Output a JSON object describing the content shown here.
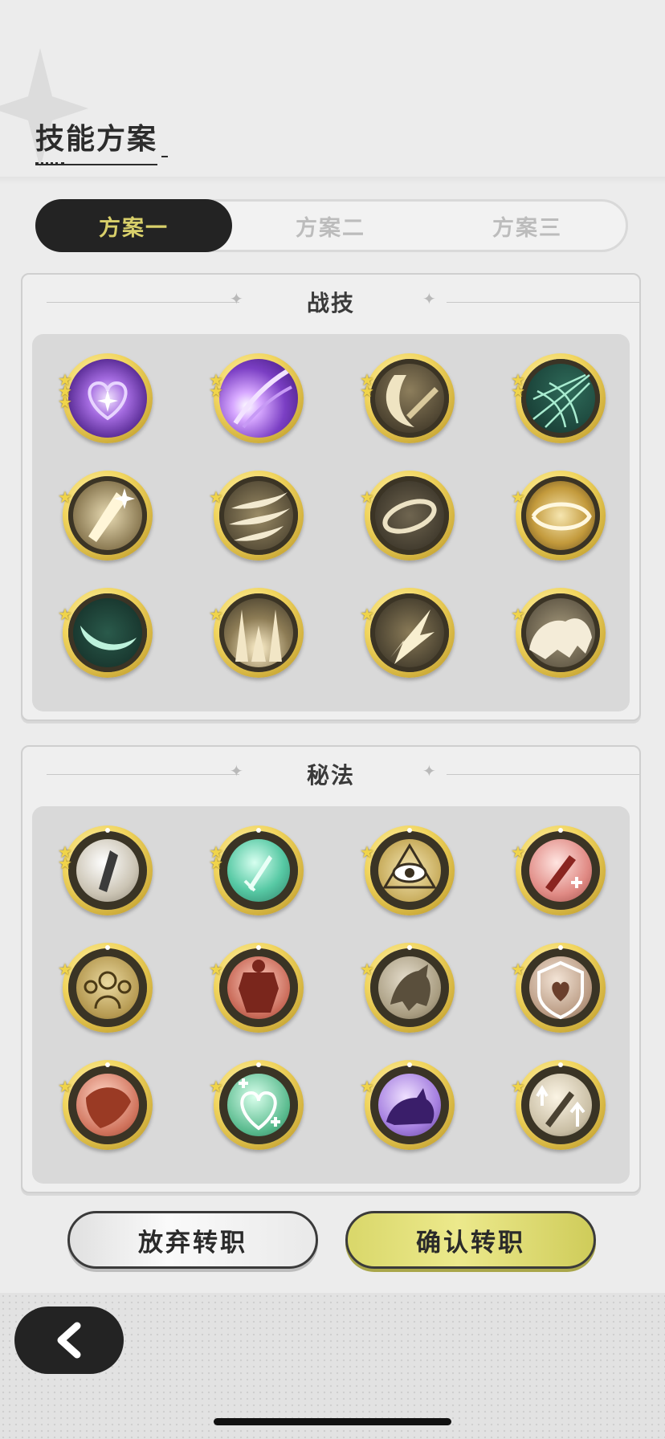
{
  "header": {
    "title": "技能方案"
  },
  "tabs": [
    {
      "label": "方案一",
      "active": true
    },
    {
      "label": "方案二",
      "active": false
    },
    {
      "label": "方案三",
      "active": false
    }
  ],
  "panels": {
    "battle": {
      "title": "战技"
    },
    "secret": {
      "title": "秘法"
    }
  },
  "buttons": {
    "abandon": "放弃转职",
    "confirm": "确认转职"
  },
  "colors": {
    "accent_tab_text": "#d8cf6a",
    "confirm_bg": "#e4e07a",
    "dark": "#232323"
  }
}
